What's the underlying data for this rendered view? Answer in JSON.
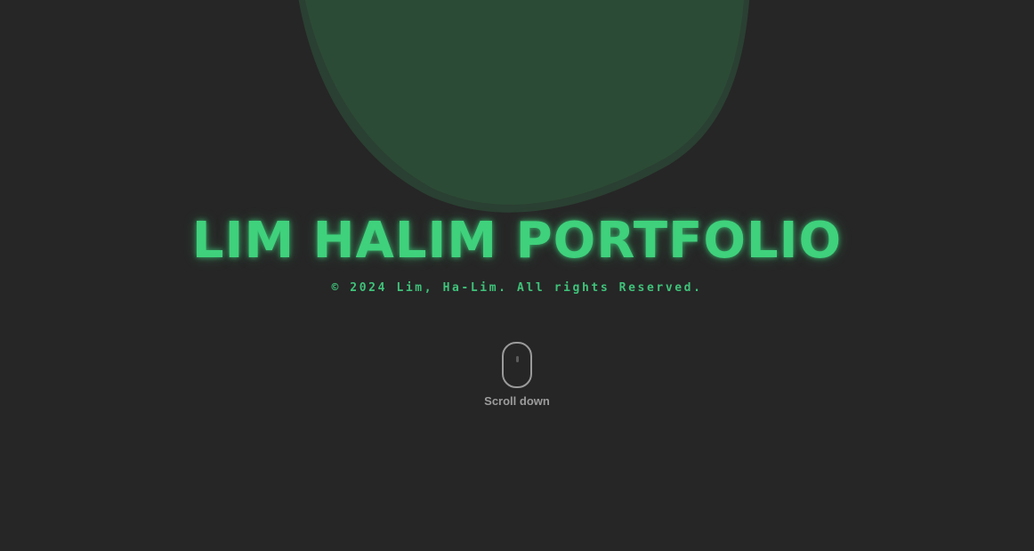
{
  "hero": {
    "title": "LIM HALIM PORTFOLIO",
    "copyright": "© 2024 Lim, Ha-Lim. All rights Reserved."
  },
  "scroll_hint": {
    "label": "Scroll down",
    "icon": "mouse-icon"
  },
  "colors": {
    "background": "#262626",
    "accent": "#3fd17c",
    "blob": "#2c4b36",
    "muted_text": "#9c9c9c"
  }
}
